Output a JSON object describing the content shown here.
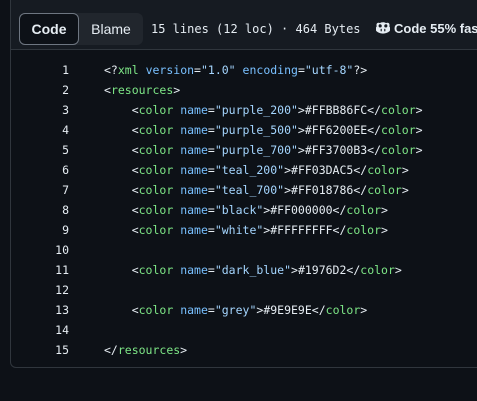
{
  "toolbar": {
    "code_label": "Code",
    "blame_label": "Blame",
    "file_info": "15 lines (12 loc) · 464 Bytes",
    "copilot_label": "Code 55% faste"
  },
  "code_lines": [
    {
      "num": "1",
      "tokens": [
        {
          "t": "<?",
          "c": "punct"
        },
        {
          "t": "xml",
          "c": "tag"
        },
        {
          "t": " ",
          "c": "text"
        },
        {
          "t": "version",
          "c": "attr"
        },
        {
          "t": "=",
          "c": "punct"
        },
        {
          "t": "\"1.0\"",
          "c": "str"
        },
        {
          "t": " ",
          "c": "text"
        },
        {
          "t": "encoding",
          "c": "attr"
        },
        {
          "t": "=",
          "c": "punct"
        },
        {
          "t": "\"utf-8\"",
          "c": "str"
        },
        {
          "t": "?>",
          "c": "punct"
        }
      ]
    },
    {
      "num": "2",
      "tokens": [
        {
          "t": "<",
          "c": "punct"
        },
        {
          "t": "resources",
          "c": "tag"
        },
        {
          "t": ">",
          "c": "punct"
        }
      ]
    },
    {
      "num": "3",
      "tokens": [
        {
          "t": "    <",
          "c": "punct"
        },
        {
          "t": "color",
          "c": "tag"
        },
        {
          "t": " ",
          "c": "text"
        },
        {
          "t": "name",
          "c": "attr"
        },
        {
          "t": "=",
          "c": "punct"
        },
        {
          "t": "\"purple_200\"",
          "c": "str"
        },
        {
          "t": ">",
          "c": "punct"
        },
        {
          "t": "#FFBB86FC",
          "c": "text"
        },
        {
          "t": "</",
          "c": "punct"
        },
        {
          "t": "color",
          "c": "tag"
        },
        {
          "t": ">",
          "c": "punct"
        }
      ]
    },
    {
      "num": "4",
      "tokens": [
        {
          "t": "    <",
          "c": "punct"
        },
        {
          "t": "color",
          "c": "tag"
        },
        {
          "t": " ",
          "c": "text"
        },
        {
          "t": "name",
          "c": "attr"
        },
        {
          "t": "=",
          "c": "punct"
        },
        {
          "t": "\"purple_500\"",
          "c": "str"
        },
        {
          "t": ">",
          "c": "punct"
        },
        {
          "t": "#FF6200EE",
          "c": "text"
        },
        {
          "t": "</",
          "c": "punct"
        },
        {
          "t": "color",
          "c": "tag"
        },
        {
          "t": ">",
          "c": "punct"
        }
      ]
    },
    {
      "num": "5",
      "tokens": [
        {
          "t": "    <",
          "c": "punct"
        },
        {
          "t": "color",
          "c": "tag"
        },
        {
          "t": " ",
          "c": "text"
        },
        {
          "t": "name",
          "c": "attr"
        },
        {
          "t": "=",
          "c": "punct"
        },
        {
          "t": "\"purple_700\"",
          "c": "str"
        },
        {
          "t": ">",
          "c": "punct"
        },
        {
          "t": "#FF3700B3",
          "c": "text"
        },
        {
          "t": "</",
          "c": "punct"
        },
        {
          "t": "color",
          "c": "tag"
        },
        {
          "t": ">",
          "c": "punct"
        }
      ]
    },
    {
      "num": "6",
      "tokens": [
        {
          "t": "    <",
          "c": "punct"
        },
        {
          "t": "color",
          "c": "tag"
        },
        {
          "t": " ",
          "c": "text"
        },
        {
          "t": "name",
          "c": "attr"
        },
        {
          "t": "=",
          "c": "punct"
        },
        {
          "t": "\"teal_200\"",
          "c": "str"
        },
        {
          "t": ">",
          "c": "punct"
        },
        {
          "t": "#FF03DAC5",
          "c": "text"
        },
        {
          "t": "</",
          "c": "punct"
        },
        {
          "t": "color",
          "c": "tag"
        },
        {
          "t": ">",
          "c": "punct"
        }
      ]
    },
    {
      "num": "7",
      "tokens": [
        {
          "t": "    <",
          "c": "punct"
        },
        {
          "t": "color",
          "c": "tag"
        },
        {
          "t": " ",
          "c": "text"
        },
        {
          "t": "name",
          "c": "attr"
        },
        {
          "t": "=",
          "c": "punct"
        },
        {
          "t": "\"teal_700\"",
          "c": "str"
        },
        {
          "t": ">",
          "c": "punct"
        },
        {
          "t": "#FF018786",
          "c": "text"
        },
        {
          "t": "</",
          "c": "punct"
        },
        {
          "t": "color",
          "c": "tag"
        },
        {
          "t": ">",
          "c": "punct"
        }
      ]
    },
    {
      "num": "8",
      "tokens": [
        {
          "t": "    <",
          "c": "punct"
        },
        {
          "t": "color",
          "c": "tag"
        },
        {
          "t": " ",
          "c": "text"
        },
        {
          "t": "name",
          "c": "attr"
        },
        {
          "t": "=",
          "c": "punct"
        },
        {
          "t": "\"black\"",
          "c": "str"
        },
        {
          "t": ">",
          "c": "punct"
        },
        {
          "t": "#FF000000",
          "c": "text"
        },
        {
          "t": "</",
          "c": "punct"
        },
        {
          "t": "color",
          "c": "tag"
        },
        {
          "t": ">",
          "c": "punct"
        }
      ]
    },
    {
      "num": "9",
      "tokens": [
        {
          "t": "    <",
          "c": "punct"
        },
        {
          "t": "color",
          "c": "tag"
        },
        {
          "t": " ",
          "c": "text"
        },
        {
          "t": "name",
          "c": "attr"
        },
        {
          "t": "=",
          "c": "punct"
        },
        {
          "t": "\"white\"",
          "c": "str"
        },
        {
          "t": ">",
          "c": "punct"
        },
        {
          "t": "#FFFFFFFF",
          "c": "text"
        },
        {
          "t": "</",
          "c": "punct"
        },
        {
          "t": "color",
          "c": "tag"
        },
        {
          "t": ">",
          "c": "punct"
        }
      ]
    },
    {
      "num": "10",
      "tokens": []
    },
    {
      "num": "11",
      "tokens": [
        {
          "t": "    <",
          "c": "punct"
        },
        {
          "t": "color",
          "c": "tag"
        },
        {
          "t": " ",
          "c": "text"
        },
        {
          "t": "name",
          "c": "attr"
        },
        {
          "t": "=",
          "c": "punct"
        },
        {
          "t": "\"dark_blue\"",
          "c": "str"
        },
        {
          "t": ">",
          "c": "punct"
        },
        {
          "t": "#1976D2",
          "c": "text"
        },
        {
          "t": "</",
          "c": "punct"
        },
        {
          "t": "color",
          "c": "tag"
        },
        {
          "t": ">",
          "c": "punct"
        }
      ]
    },
    {
      "num": "12",
      "tokens": []
    },
    {
      "num": "13",
      "tokens": [
        {
          "t": "    <",
          "c": "punct"
        },
        {
          "t": "color",
          "c": "tag"
        },
        {
          "t": " ",
          "c": "text"
        },
        {
          "t": "name",
          "c": "attr"
        },
        {
          "t": "=",
          "c": "punct"
        },
        {
          "t": "\"grey\"",
          "c": "str"
        },
        {
          "t": ">",
          "c": "punct"
        },
        {
          "t": "#9E9E9E",
          "c": "text"
        },
        {
          "t": "</",
          "c": "punct"
        },
        {
          "t": "color",
          "c": "tag"
        },
        {
          "t": ">",
          "c": "punct"
        }
      ]
    },
    {
      "num": "14",
      "tokens": []
    },
    {
      "num": "15",
      "tokens": [
        {
          "t": "</",
          "c": "punct"
        },
        {
          "t": "resources",
          "c": "tag"
        },
        {
          "t": ">",
          "c": "punct"
        }
      ]
    }
  ],
  "colors": {
    "background": "#0d1117",
    "toolbar": "#161b22",
    "border": "#30363d",
    "tag": "#7ee787",
    "attr": "#79c0ff",
    "string": "#a5d6ff",
    "text": "#e6edf3"
  },
  "icons": {
    "copilot": "copilot-icon"
  }
}
